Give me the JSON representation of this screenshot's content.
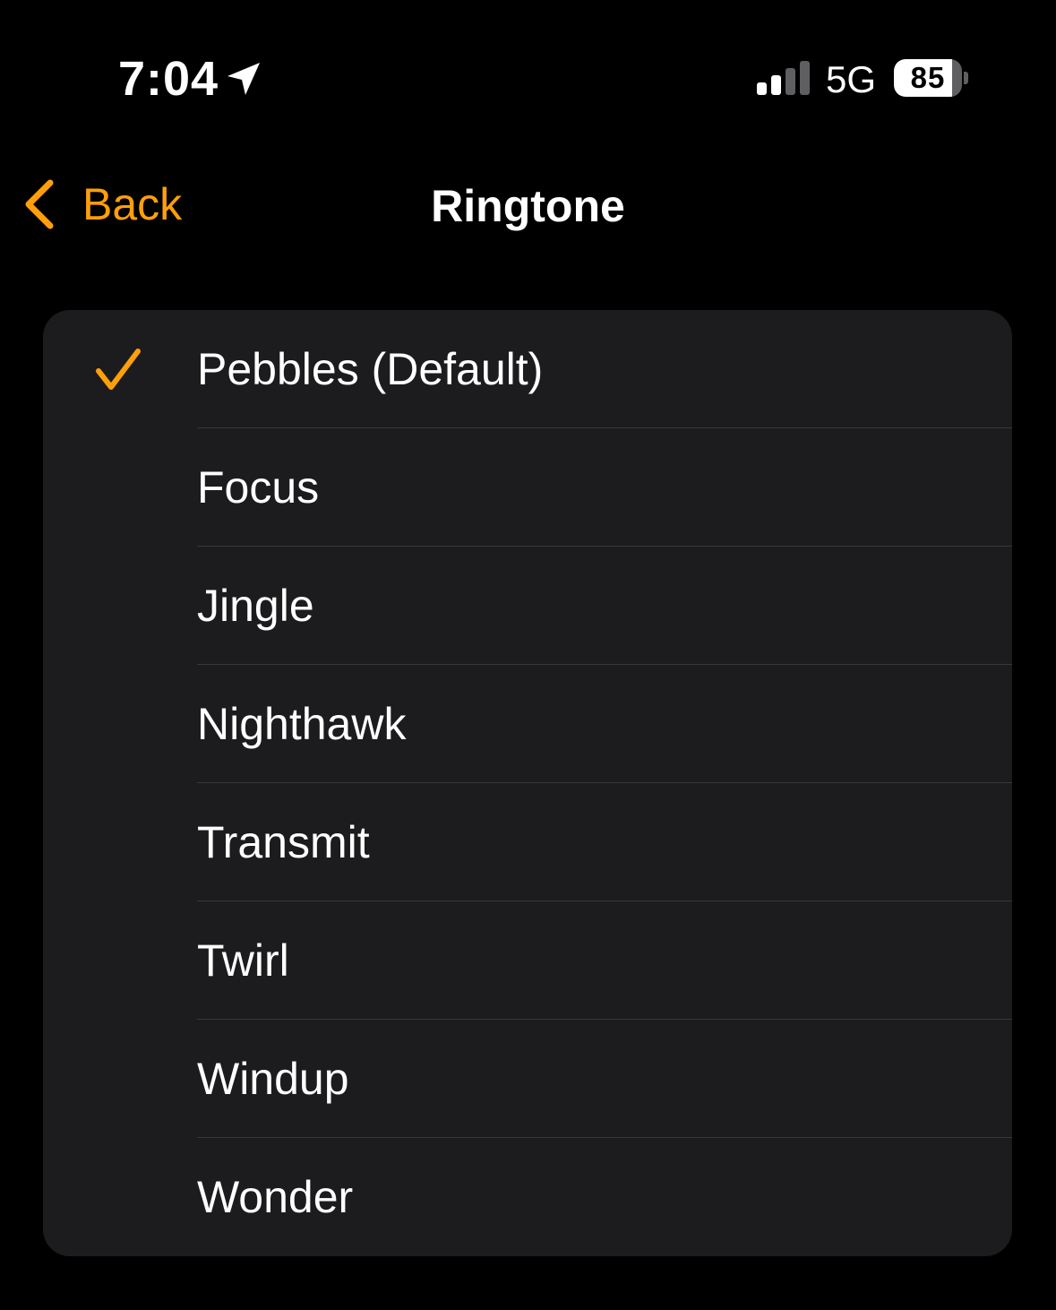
{
  "status_bar": {
    "time": "7:04",
    "network": "5G",
    "battery_level": "85",
    "battery_fraction": 0.85,
    "icons": [
      "location-arrow-icon",
      "cellular-signal-icon",
      "battery-icon"
    ]
  },
  "nav": {
    "back_label": "Back",
    "title": "Ringtone",
    "back_icon": "chevron-left-icon"
  },
  "colors": {
    "accent": "#ff9f0a",
    "background": "#000000",
    "group_background": "#1c1c1e",
    "separator": "#38383a",
    "text": "#ffffff"
  },
  "ringtones": {
    "items": [
      {
        "label": "Pebbles (Default)",
        "selected": true
      },
      {
        "label": "Focus",
        "selected": false
      },
      {
        "label": "Jingle",
        "selected": false
      },
      {
        "label": "Nighthawk",
        "selected": false
      },
      {
        "label": "Transmit",
        "selected": false
      },
      {
        "label": "Twirl",
        "selected": false
      },
      {
        "label": "Windup",
        "selected": false
      },
      {
        "label": "Wonder",
        "selected": false
      }
    ],
    "selected_icon": "checkmark-icon"
  }
}
